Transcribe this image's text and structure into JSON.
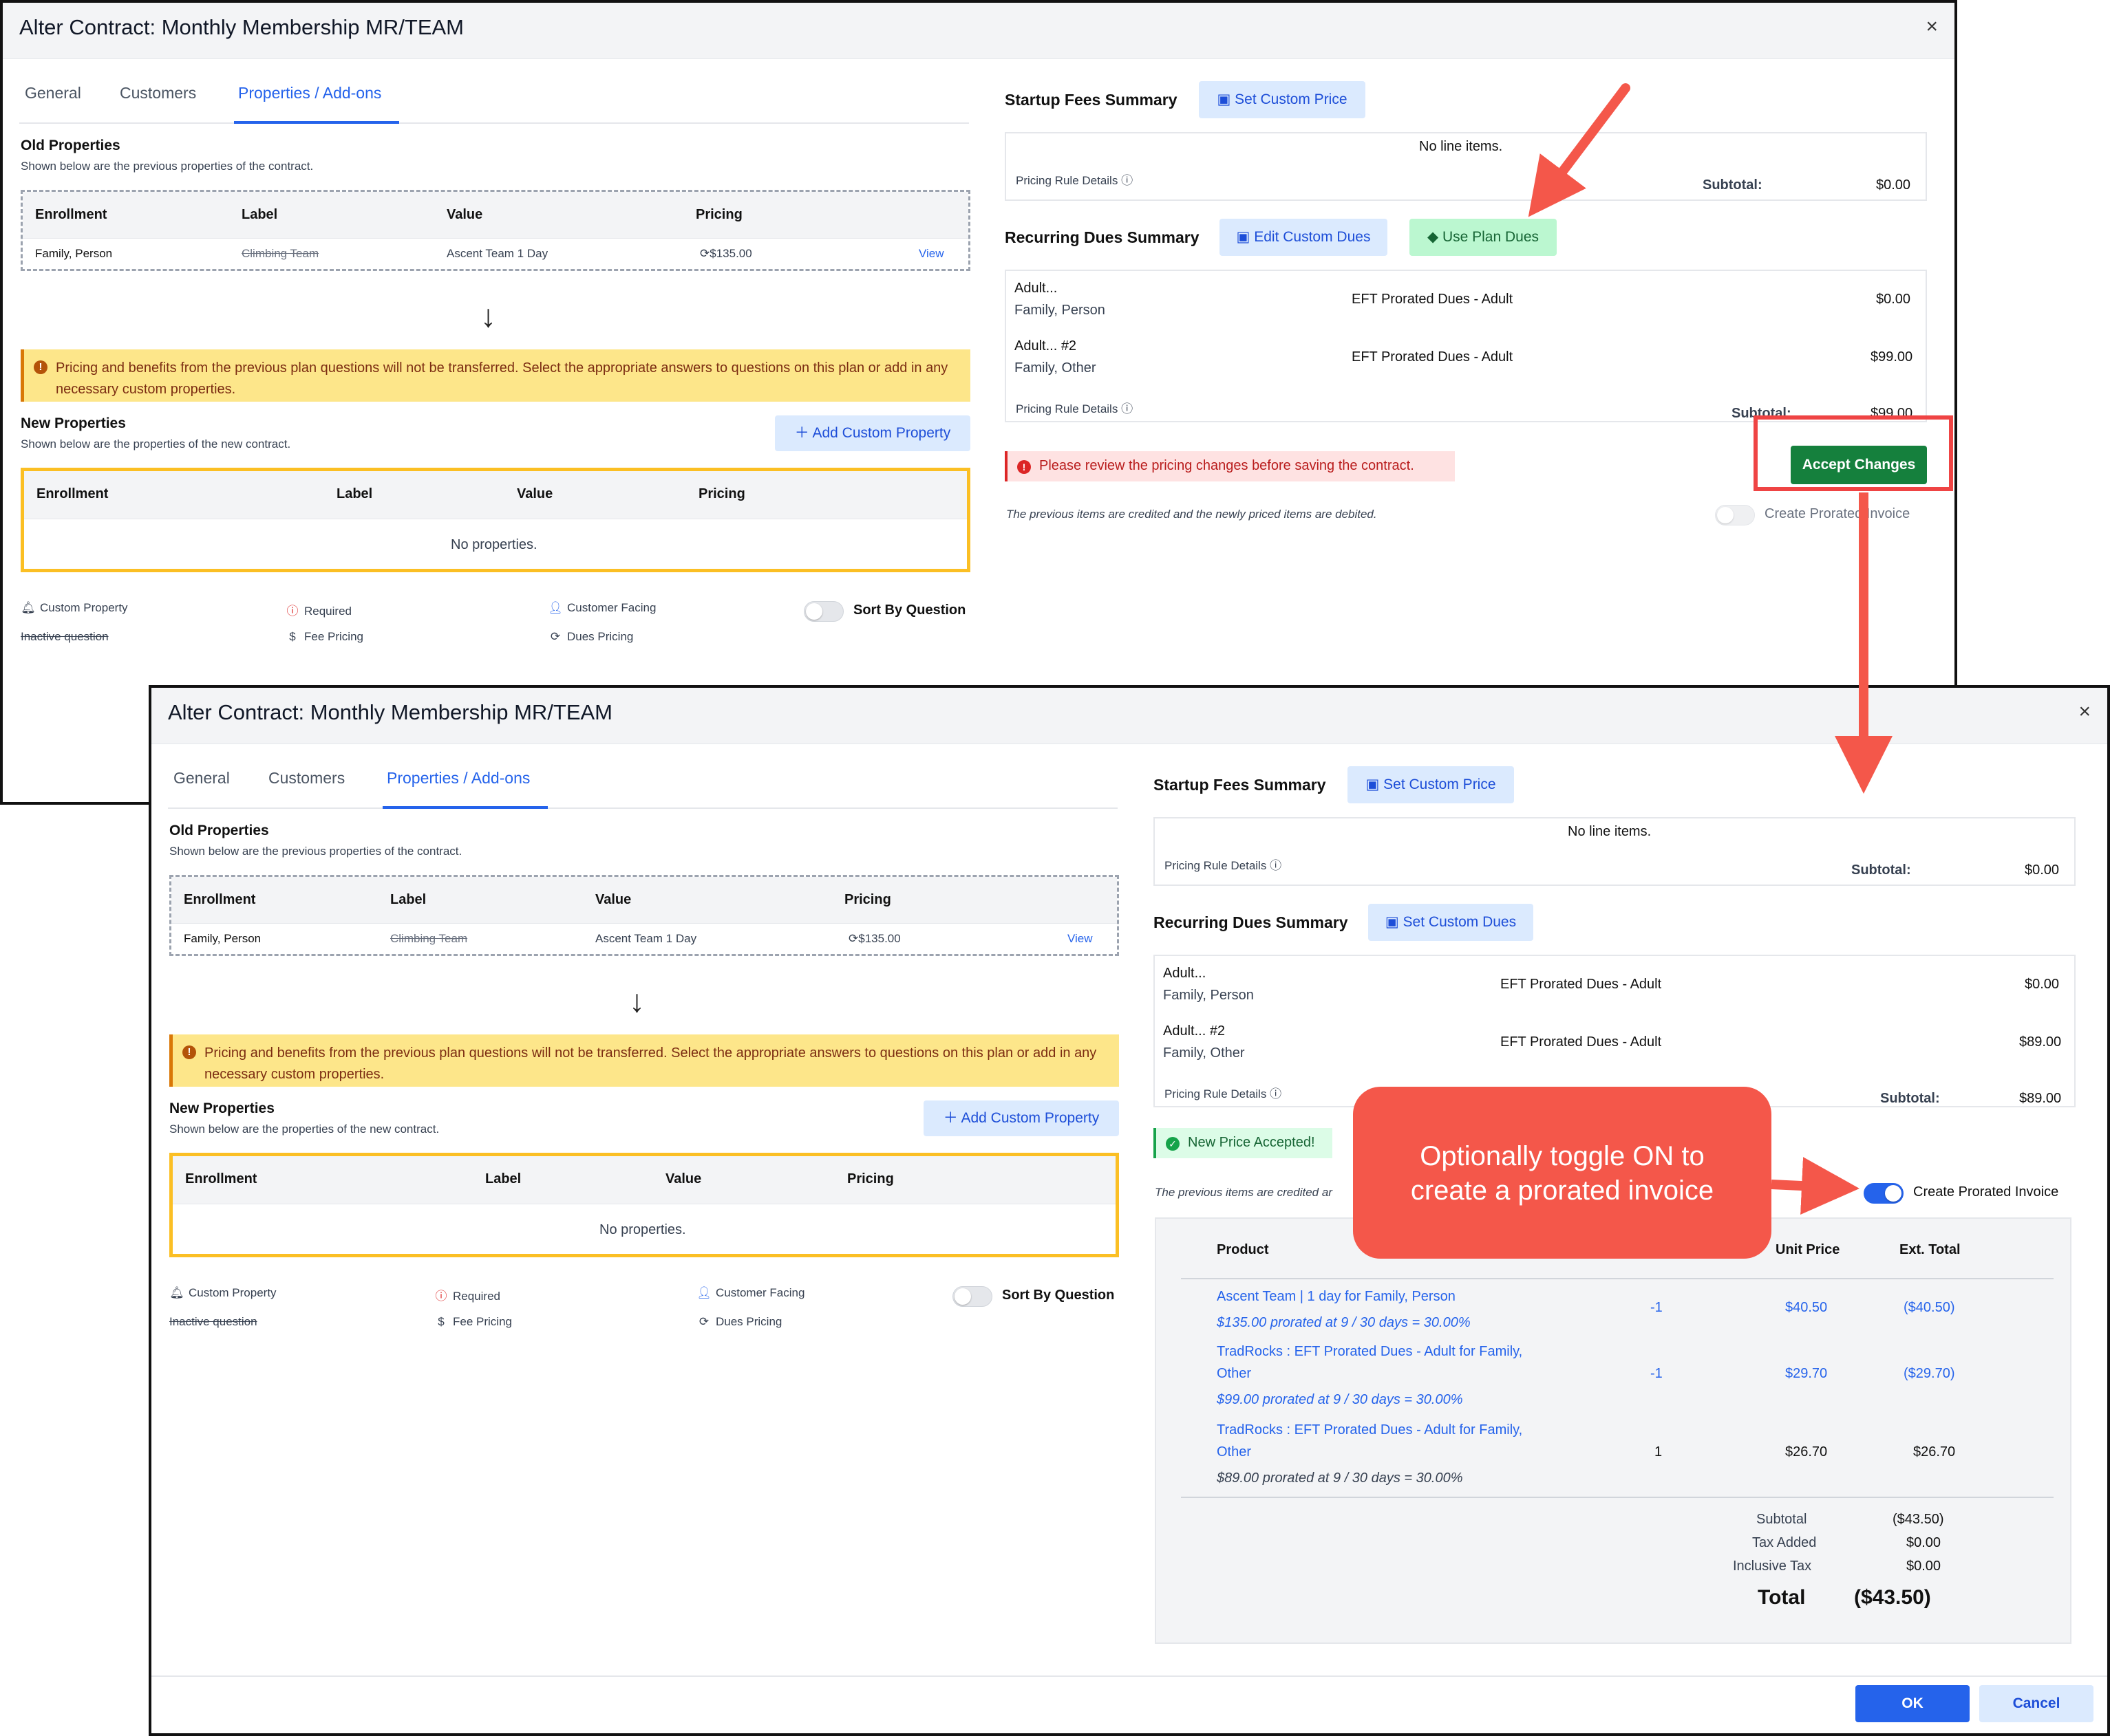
{
  "window": {
    "title": "Alter Contract: Monthly Membership MR/TEAM",
    "close": "×",
    "tabs": [
      "General",
      "Customers",
      "Properties / Add-ons"
    ]
  },
  "old_properties": {
    "heading": "Old Properties",
    "subtitle": "Shown below are the previous properties of the contract.",
    "columns": [
      "Enrollment",
      "Label",
      "Value",
      "Pricing"
    ],
    "row": {
      "enrollment": "Family, Person",
      "label": "Climbing Team",
      "value": "Ascent Team 1 Day",
      "pricing": "$135.00",
      "action": "View"
    }
  },
  "arrow": "↓",
  "warning": "Pricing and benefits from the previous plan questions will not be transferred. Select the appropriate answers to questions on this plan or add in any necessary custom properties.",
  "new_properties": {
    "heading": "New Properties",
    "subtitle": "Shown below are the properties of the new contract.",
    "add_button": "Add Custom Property",
    "columns": [
      "Enrollment",
      "Label",
      "Value",
      "Pricing"
    ],
    "empty": "No properties."
  },
  "legend": {
    "custom_property": "Custom Property",
    "inactive_question": "Inactive question",
    "required": "Required",
    "fee_pricing": "Fee Pricing",
    "customer_facing": "Customer Facing",
    "dues_pricing": "Dues Pricing",
    "sort_by_question": "Sort By Question"
  },
  "startup": {
    "title": "Startup Fees Summary",
    "button": "Set Custom Price",
    "empty": "No line items.",
    "rule_details": "Pricing Rule Details",
    "subtotal_label": "Subtotal:",
    "subtotal": "$0.00"
  },
  "recurring1": {
    "title": "Recurring Dues Summary",
    "edit_button": "Edit Custom Dues",
    "plan_button": "Use Plan Dues",
    "rows": [
      {
        "name": "Adult...",
        "who": "Family, Person",
        "desc": "EFT Prorated Dues - Adult",
        "amount": "$0.00"
      },
      {
        "name": "Adult... #2",
        "who": "Family, Other",
        "desc": "EFT Prorated Dues - Adult",
        "amount": "$99.00"
      }
    ],
    "rule_details": "Pricing Rule Details",
    "subtotal_label": "Subtotal:",
    "subtotal": "$99.00",
    "error": "Please review the pricing changes before saving the contract.",
    "accept": "Accept Changes",
    "note": "The previous items are credited and the newly priced items are debited.",
    "prorated_label": "Create Prorated Invoice"
  },
  "recurring2": {
    "title": "Recurring Dues Summary",
    "button": "Set Custom Dues",
    "rows": [
      {
        "name": "Adult...",
        "who": "Family, Person",
        "desc": "EFT Prorated Dues - Adult",
        "amount": "$0.00"
      },
      {
        "name": "Adult... #2",
        "who": "Family, Other",
        "desc": "EFT Prorated Dues - Adult",
        "amount": "$89.00"
      }
    ],
    "rule_details": "Pricing Rule Details",
    "subtotal_label": "Subtotal:",
    "subtotal": "$89.00",
    "accepted": "New Price Accepted!",
    "note": "The previous items are credited ar",
    "prorated_label": "Create Prorated Invoice"
  },
  "invoice": {
    "columns": [
      "Product",
      "Unit Price",
      "Ext. Total"
    ],
    "items": [
      {
        "line1": "Ascent Team | 1 day for Family, Person",
        "line2": "",
        "detail": "$135.00 prorated at 9 / 30 days = 30.00%",
        "qty": "-1",
        "unit": "$40.50",
        "ext": "($40.50)"
      },
      {
        "line1": "TradRocks : EFT Prorated Dues - Adult for Family,",
        "line2": "Other",
        "detail": "$99.00 prorated at 9 / 30 days = 30.00%",
        "qty": "-1",
        "unit": "$29.70",
        "ext": "($29.70)"
      },
      {
        "line1": "TradRocks : EFT Prorated Dues - Adult for Family,",
        "line2": "Other",
        "detail": "$89.00 prorated at 9 / 30 days = 30.00%",
        "qty": "1",
        "unit": "$26.70",
        "ext": "$26.70"
      }
    ],
    "subtotal_label": "Subtotal",
    "subtotal": "($43.50)",
    "tax_label": "Tax Added",
    "tax": "$0.00",
    "inclusive_label": "Inclusive Tax",
    "inclusive": "$0.00",
    "total_label": "Total",
    "total": "($43.50)"
  },
  "footer": {
    "ok": "OK",
    "cancel": "Cancel"
  },
  "callout": {
    "line1": "Optionally toggle ON to",
    "line2": "create a prorated invoice"
  },
  "colors": {
    "accent": "#2563eb",
    "warning_bg": "#fde68a",
    "annotation": "#f4574a",
    "accept_green": "#15803d"
  }
}
